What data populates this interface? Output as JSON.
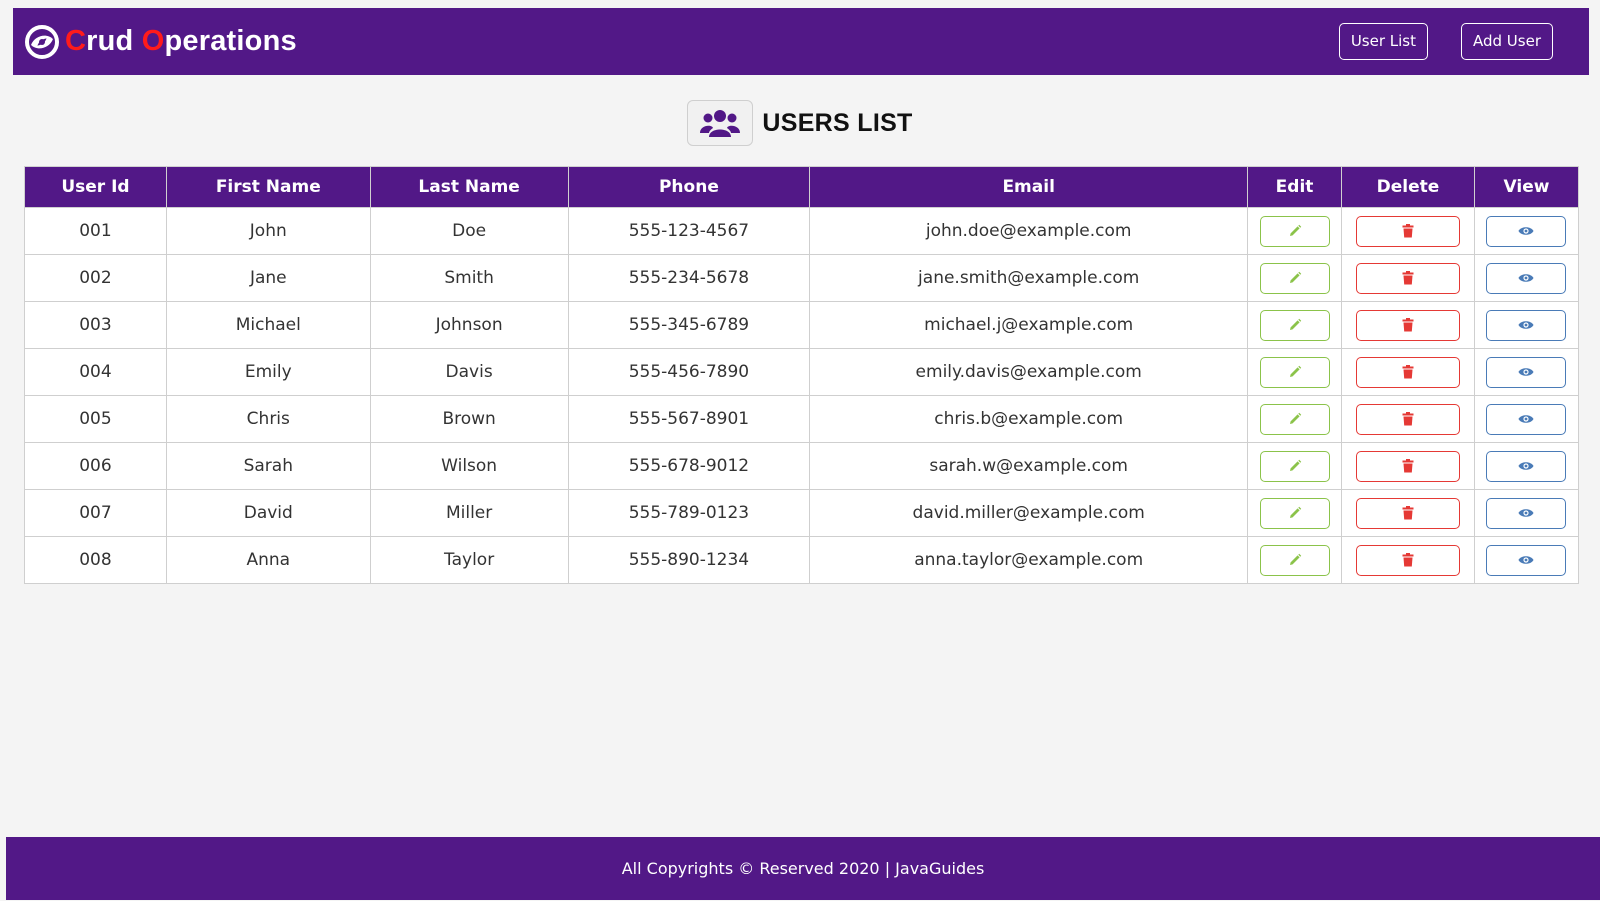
{
  "brand": {
    "first_letter": "C",
    "first_rest": "rud ",
    "second_letter": "O",
    "second_rest": "perations"
  },
  "nav": {
    "user_list_label": "User List",
    "add_user_label": "Add User"
  },
  "page": {
    "title": "USERS LIST"
  },
  "table": {
    "headers": {
      "id": "User Id",
      "first_name": "First Name",
      "last_name": "Last Name",
      "phone": "Phone",
      "email": "Email",
      "edit": "Edit",
      "delete": "Delete",
      "view": "View"
    },
    "rows": [
      {
        "id": "001",
        "first_name": "John",
        "last_name": "Doe",
        "phone": "555-123-4567",
        "email": "john.doe@example.com"
      },
      {
        "id": "002",
        "first_name": "Jane",
        "last_name": "Smith",
        "phone": "555-234-5678",
        "email": "jane.smith@example.com"
      },
      {
        "id": "003",
        "first_name": "Michael",
        "last_name": "Johnson",
        "phone": "555-345-6789",
        "email": "michael.j@example.com"
      },
      {
        "id": "004",
        "first_name": "Emily",
        "last_name": "Davis",
        "phone": "555-456-7890",
        "email": "emily.davis@example.com"
      },
      {
        "id": "005",
        "first_name": "Chris",
        "last_name": "Brown",
        "phone": "555-567-8901",
        "email": "chris.b@example.com"
      },
      {
        "id": "006",
        "first_name": "Sarah",
        "last_name": "Wilson",
        "phone": "555-678-9012",
        "email": "sarah.w@example.com"
      },
      {
        "id": "007",
        "first_name": "David",
        "last_name": "Miller",
        "phone": "555-789-0123",
        "email": "david.miller@example.com"
      },
      {
        "id": "008",
        "first_name": "Anna",
        "last_name": "Taylor",
        "phone": "555-890-1234",
        "email": "anna.taylor@example.com"
      }
    ]
  },
  "icons": {
    "brand": "swirl-logo-icon",
    "title": "users-group-icon",
    "edit": "pencil-icon",
    "delete": "trash-icon",
    "view": "eye-icon"
  },
  "footer": {
    "text": "All Copyrights © Reserved 2020 | JavaGuides"
  },
  "colors": {
    "primary": "#521887",
    "brand_accent": "#ff1b1b",
    "edit": "#8bc34a",
    "delete": "#e53935",
    "view": "#4a7bb7"
  }
}
